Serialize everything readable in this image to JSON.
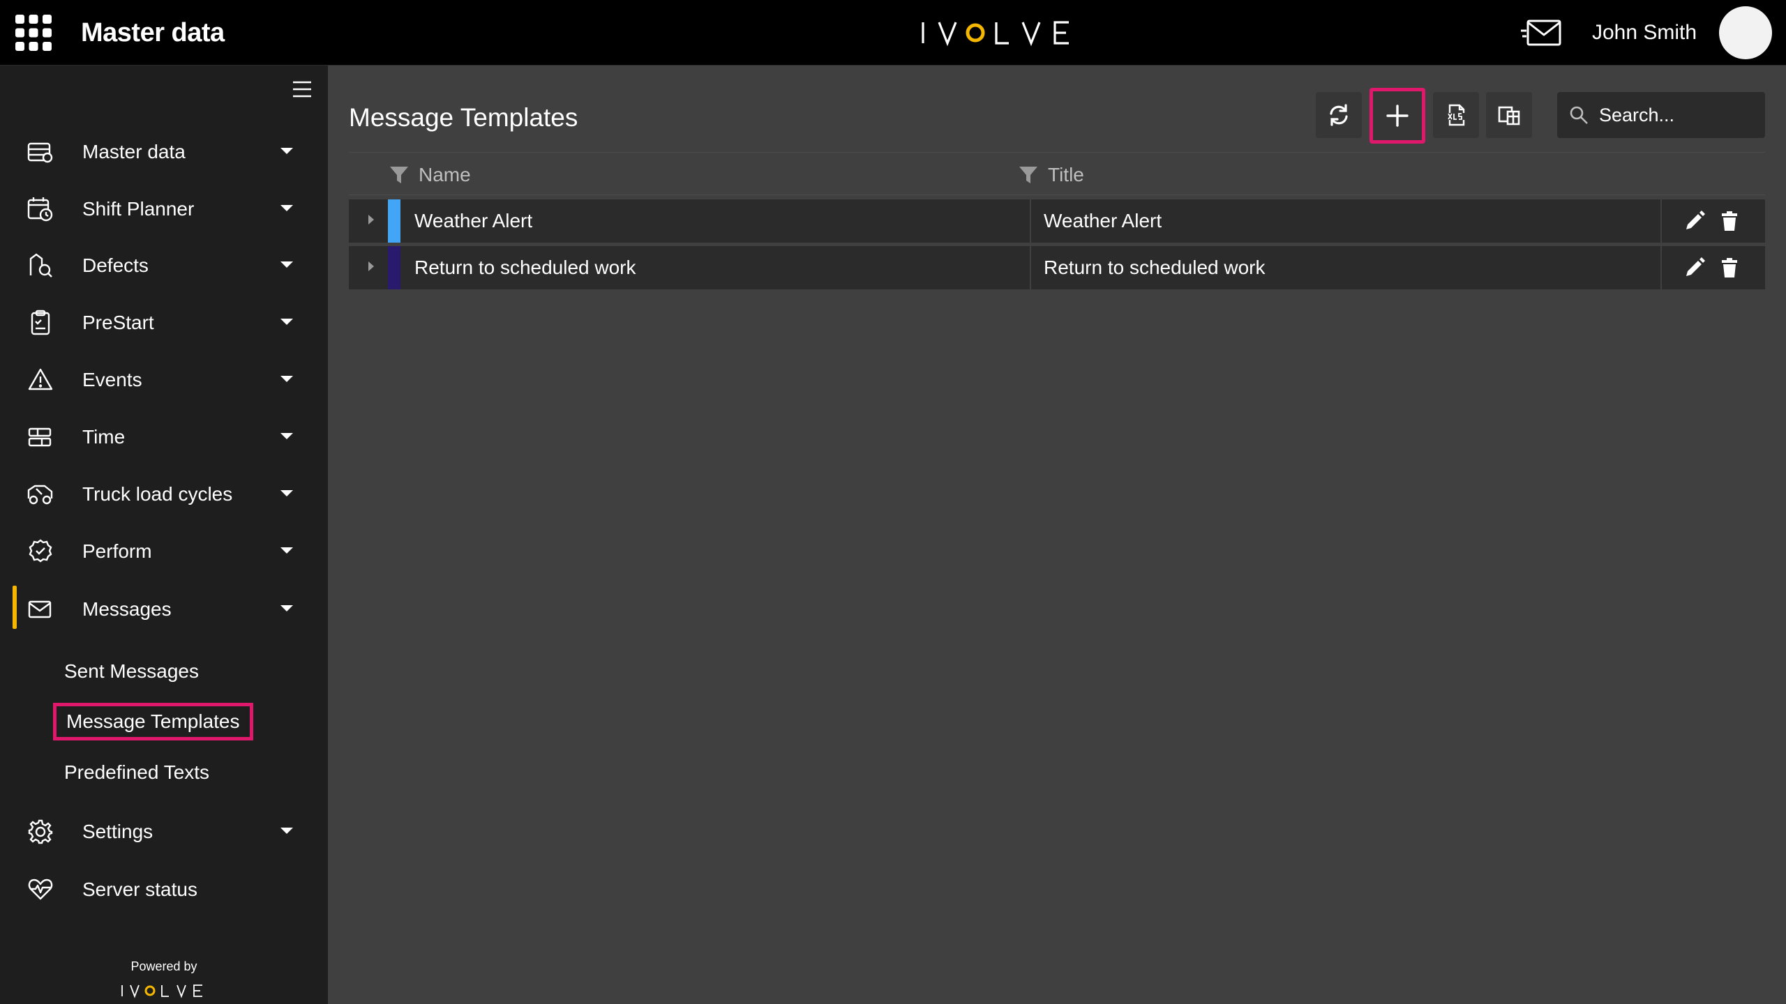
{
  "header": {
    "app_title": "Master data",
    "brand": "IVOLVE",
    "user_name": "John Smith"
  },
  "sidebar": {
    "items": [
      {
        "label": "Master data",
        "icon": "master-data-icon"
      },
      {
        "label": "Shift Planner",
        "icon": "shift-planner-icon"
      },
      {
        "label": "Defects",
        "icon": "defects-icon"
      },
      {
        "label": "PreStart",
        "icon": "clipboard-icon"
      },
      {
        "label": "Events",
        "icon": "warning-icon"
      },
      {
        "label": "Time",
        "icon": "time-icon"
      },
      {
        "label": "Truck load cycles",
        "icon": "truck-icon"
      },
      {
        "label": "Perform",
        "icon": "perform-icon"
      },
      {
        "label": "Messages",
        "icon": "envelope-icon",
        "active": true
      },
      {
        "label": "Settings",
        "icon": "gear-icon"
      },
      {
        "label": "Server status",
        "icon": "heartbeat-icon"
      }
    ],
    "messages_subitems": [
      {
        "label": "Sent Messages"
      },
      {
        "label": "Message Templates",
        "selected": true
      },
      {
        "label": "Predefined Texts"
      }
    ],
    "powered_by": "Powered by",
    "powered_brand": "IVOLVE"
  },
  "main": {
    "page_title": "Message Templates",
    "toolbar": {
      "refresh": "refresh-icon",
      "add": "plus-icon",
      "export": "xlsx-export-icon",
      "columns": "column-chooser-icon"
    },
    "search": {
      "placeholder": "Search..."
    },
    "table": {
      "columns": [
        "Name",
        "Title"
      ],
      "rows": [
        {
          "name": "Weather Alert",
          "title": "Weather Alert",
          "color": "#42a5f5"
        },
        {
          "name": "Return to scheduled work",
          "title": "Return to scheduled work",
          "color": "#2a1a6e"
        }
      ]
    }
  },
  "colors": {
    "accent_highlight": "#e0186c",
    "active_indicator": "#f5b700",
    "brand_ring": "#f5b700"
  }
}
